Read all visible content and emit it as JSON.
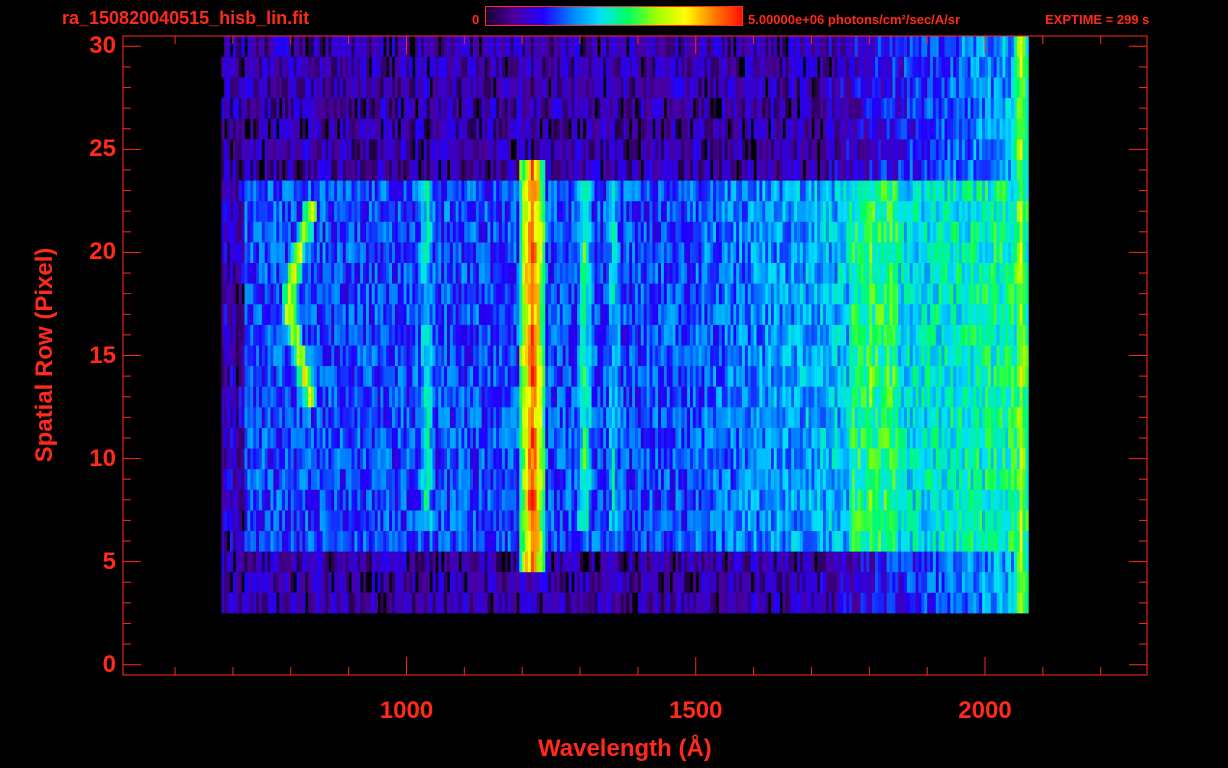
{
  "header": {
    "title": "ra_150820040515_hisb_lin.fit",
    "colorbar_min": "0",
    "colorbar_max": "5.00000e+06 photons/cm²/sec/A/sr",
    "exptime": "EXPTIME = 299 s"
  },
  "colors": {
    "axis": "#ff2a1a",
    "background": "#000000"
  },
  "colormap": [
    "#1a0030",
    "#4a00a0",
    "#2000ff",
    "#0080ff",
    "#00e0ff",
    "#00ff60",
    "#a0ff00",
    "#ffff00",
    "#ff8000",
    "#ff1000"
  ],
  "chart_data": {
    "type": "heatmap",
    "title": "ra_150820040515_hisb_lin.fit",
    "xlabel": "Wavelength (Å)",
    "ylabel": "Spatial Row (Pixel)",
    "xlim": [
      510,
      2280
    ],
    "ylim": [
      -0.5,
      30.5
    ],
    "xticks": [
      "1000",
      "1500",
      "2000"
    ],
    "xtick_values": [
      1000,
      1500,
      2000
    ],
    "yticks": [
      "0",
      "5",
      "10",
      "15",
      "20",
      "25",
      "30"
    ],
    "ytick_values": [
      0,
      5,
      10,
      15,
      20,
      25,
      30
    ],
    "color_range": [
      0,
      5000000
    ],
    "color_units": "photons/cm²/sec/A/sr",
    "data_extent": {
      "wavelength": [
        680,
        2070
      ],
      "rows_bright": [
        6,
        23
      ],
      "rows_faint": [
        3,
        30
      ]
    },
    "features": [
      {
        "name": "bright line",
        "wavelength": 1215,
        "rows": [
          5,
          24
        ],
        "level": 0.95
      },
      {
        "name": "crescent",
        "wavelength": 790,
        "rows": [
          13,
          22
        ],
        "level": 0.75
      },
      {
        "name": "line",
        "wavelength": 1032,
        "rows": [
          7,
          23
        ],
        "level": 0.5
      },
      {
        "name": "line",
        "wavelength": 1305,
        "rows": [
          7,
          23
        ],
        "level": 0.55
      },
      {
        "name": "line",
        "wavelength": 1356,
        "rows": [
          7,
          23
        ],
        "level": 0.45
      },
      {
        "name": "band",
        "wavelength": 1800,
        "rows": [
          6,
          23
        ],
        "level": 0.6
      },
      {
        "name": "red edge",
        "wavelength": 2060,
        "rows": [
          2,
          30
        ],
        "level": 0.7
      }
    ]
  }
}
